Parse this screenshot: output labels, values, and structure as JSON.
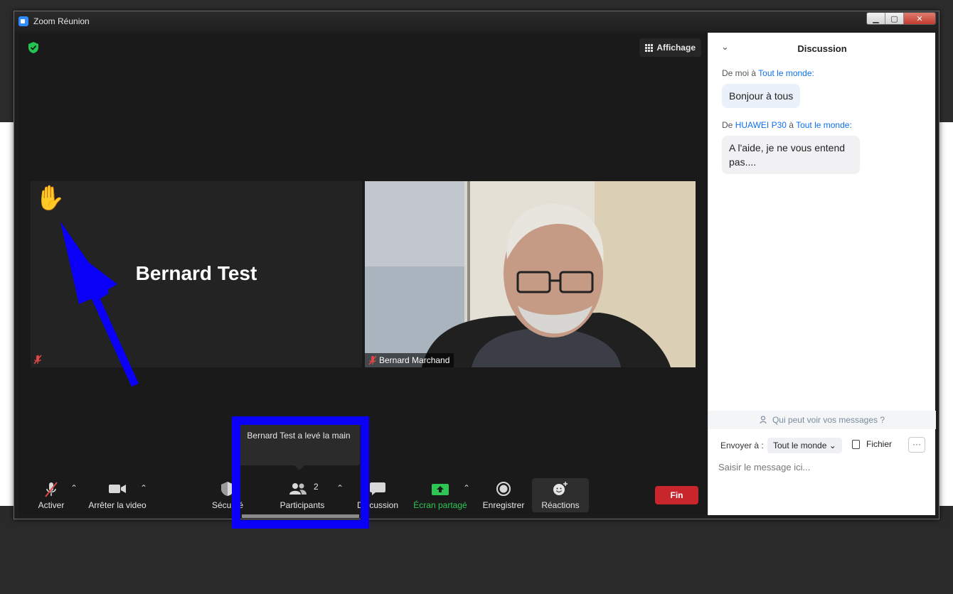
{
  "window": {
    "title": "Zoom Réunion",
    "minimize": "▁",
    "maximize": "▢",
    "close": "✕"
  },
  "meeting": {
    "view_button": "Affichage",
    "tile_left": {
      "name": "Bernard Test",
      "hand": "✋"
    },
    "tile_right": {
      "name": "Bernard Marchand"
    },
    "tooltip": "Bernard Test a levé la main"
  },
  "toolbar": {
    "mute_label": "Activer",
    "video_label": "Arrêter la video",
    "security_label": "Sécurité",
    "participants_label": "Participants",
    "participants_count": "2",
    "chat_label": "Discussion",
    "share_label": "Écran partagé",
    "record_label": "Enregistrer",
    "reactions_label": "Réactions",
    "end_label": "Fin",
    "caret": "⌃"
  },
  "chat": {
    "title": "Discussion",
    "messages": [
      {
        "from_prefix": "De moi à ",
        "from": "",
        "to_prefix": "",
        "to": "Tout le monde:",
        "text": "Bonjour à tous"
      },
      {
        "from_prefix": "De ",
        "from": "HUAWEI P30",
        "to_prefix": " à ",
        "to": "Tout le monde:",
        "text": "A l'aide, je ne vous entend pas...."
      }
    ],
    "who_sees": "Qui peut voir vos messages ?",
    "send_to_label": "Envoyer à :",
    "send_to_value": "Tout le monde ⌄",
    "file_label": "Fichier",
    "more": "···",
    "input_placeholder": "Saisir le message ici..."
  },
  "colors": {
    "accent": "#0e72ed",
    "end": "#c9252c",
    "share": "#2dc653",
    "annotation": "#0a00f7"
  }
}
